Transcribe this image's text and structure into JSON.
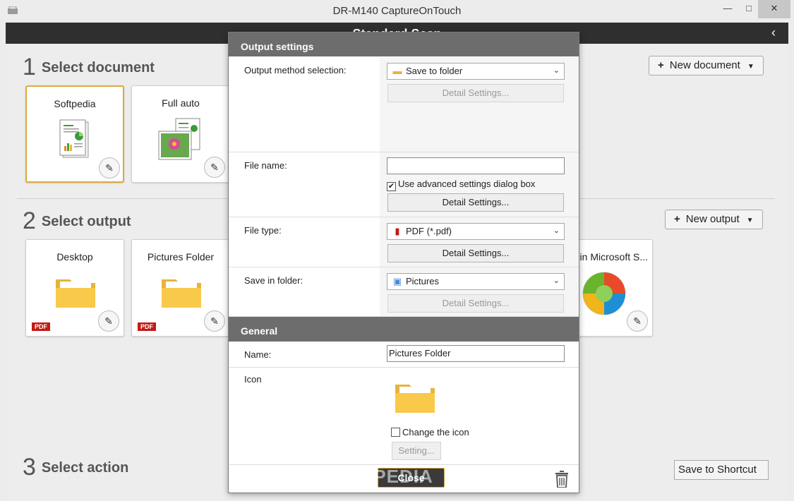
{
  "window": {
    "title": "DR-M140 CaptureOnTouch",
    "minimize": "—",
    "maximize": "□",
    "close": "✕"
  },
  "header": {
    "title": "Standard Scan",
    "back": "‹"
  },
  "sections": {
    "document": {
      "num": "1",
      "label": "Select document",
      "new_btn": "New document"
    },
    "output": {
      "num": "2",
      "label": "Select output",
      "new_btn": "New output"
    },
    "action": {
      "num": "3",
      "label": "Select action",
      "shortcut": "Save to Shortcut"
    }
  },
  "documents": [
    {
      "label": "Softpedia",
      "selected": true
    },
    {
      "label": "Full auto",
      "selected": false
    }
  ],
  "outputs": [
    {
      "label": "Desktop",
      "badge": "PDF"
    },
    {
      "label": "Pictures Folder",
      "badge": "PDF"
    },
    {
      "label": "in Microsoft S..."
    }
  ],
  "dialog": {
    "output_header": "Output settings",
    "output_method_label": "Output method selection:",
    "output_method_value": "Save to folder",
    "detail_settings": "Detail Settings...",
    "file_name_label": "File name:",
    "file_name_value": "",
    "use_advanced_label": "Use advanced settings dialog box",
    "use_advanced_checked": true,
    "file_type_label": "File type:",
    "file_type_value": "PDF (*.pdf)",
    "save_folder_label": "Save in folder:",
    "save_folder_value": "Pictures",
    "general_header": "General",
    "name_label": "Name:",
    "name_value": "Pictures Folder",
    "icon_label": "Icon",
    "change_icon_label": "Change the icon",
    "change_icon_checked": false,
    "setting_btn": "Setting...",
    "close_btn": "Close"
  },
  "watermark": "SOFTPEDIA",
  "colors": {
    "accent": "#e0a93a",
    "header_bg": "#2f2f2f",
    "section_bar": "#6d6d6d",
    "pdf_red": "#c21b17"
  }
}
